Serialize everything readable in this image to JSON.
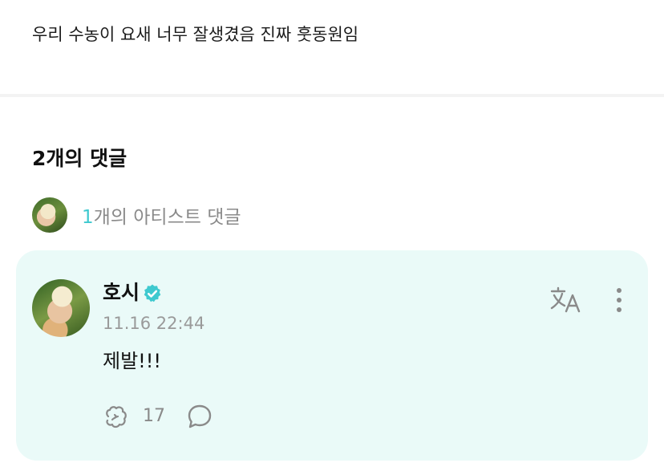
{
  "post": {
    "body": "우리 수농이 요새 너무 잘생겼음 진짜 훗동원임"
  },
  "comments": {
    "heading": "2개의 댓글",
    "artist_summary": {
      "count": "1",
      "label": "개의 아티스트 댓글"
    },
    "items": [
      {
        "author": "호시",
        "verified": true,
        "timestamp": "11.16 22:44",
        "text": "제발!!!",
        "like_count": "17"
      }
    ]
  },
  "icons": {
    "verified": "verified-badge-icon",
    "translate": "translate-icon",
    "more": "more-vertical-icon",
    "like": "like-icon",
    "reply": "reply-bubble-icon"
  },
  "colors": {
    "accent": "#3ec9cf",
    "card_background": "#eafaf8",
    "muted_text": "#8a8a8a"
  }
}
